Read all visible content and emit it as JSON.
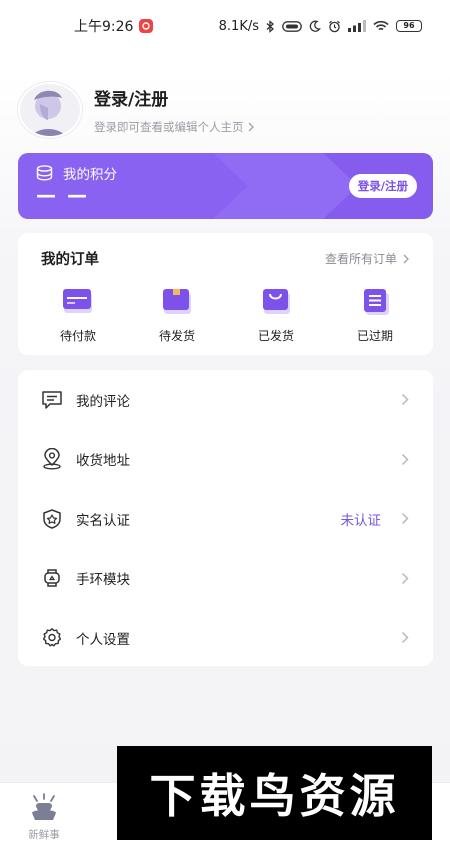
{
  "status_bar": {
    "time": "上午9:26",
    "network_speed": "8.1K/s",
    "battery": "96",
    "icons": [
      "app-notification-icon",
      "bluetooth-icon",
      "volte-icon",
      "moon-icon",
      "alarm-icon",
      "signal-icon",
      "wifi-icon",
      "battery-icon"
    ]
  },
  "profile": {
    "name": "登录/注册",
    "hint": "登录即可查看或编辑个人主页"
  },
  "points": {
    "title": "我的积分",
    "value": "— —",
    "login_button": "登录/注册",
    "accent": "#8a62f1"
  },
  "orders": {
    "title": "我的订单",
    "view_all": "查看所有订单",
    "items": [
      {
        "label": "待付款",
        "icon": "card-icon"
      },
      {
        "label": "待发货",
        "icon": "box-icon"
      },
      {
        "label": "已发货",
        "icon": "bag-icon"
      },
      {
        "label": "已过期",
        "icon": "list-icon"
      }
    ]
  },
  "menu": {
    "items": [
      {
        "label": "我的评论",
        "icon": "comment-icon",
        "value": ""
      },
      {
        "label": "收货地址",
        "icon": "location-icon",
        "value": ""
      },
      {
        "label": "实名认证",
        "icon": "shield-icon",
        "value": "未认证"
      },
      {
        "label": "手环模块",
        "icon": "wristband-icon",
        "value": ""
      },
      {
        "label": "个人设置",
        "icon": "gear-icon",
        "value": ""
      }
    ]
  },
  "bottom": {
    "tab_label": "新鲜事",
    "watermark": "下载鸟资源"
  }
}
